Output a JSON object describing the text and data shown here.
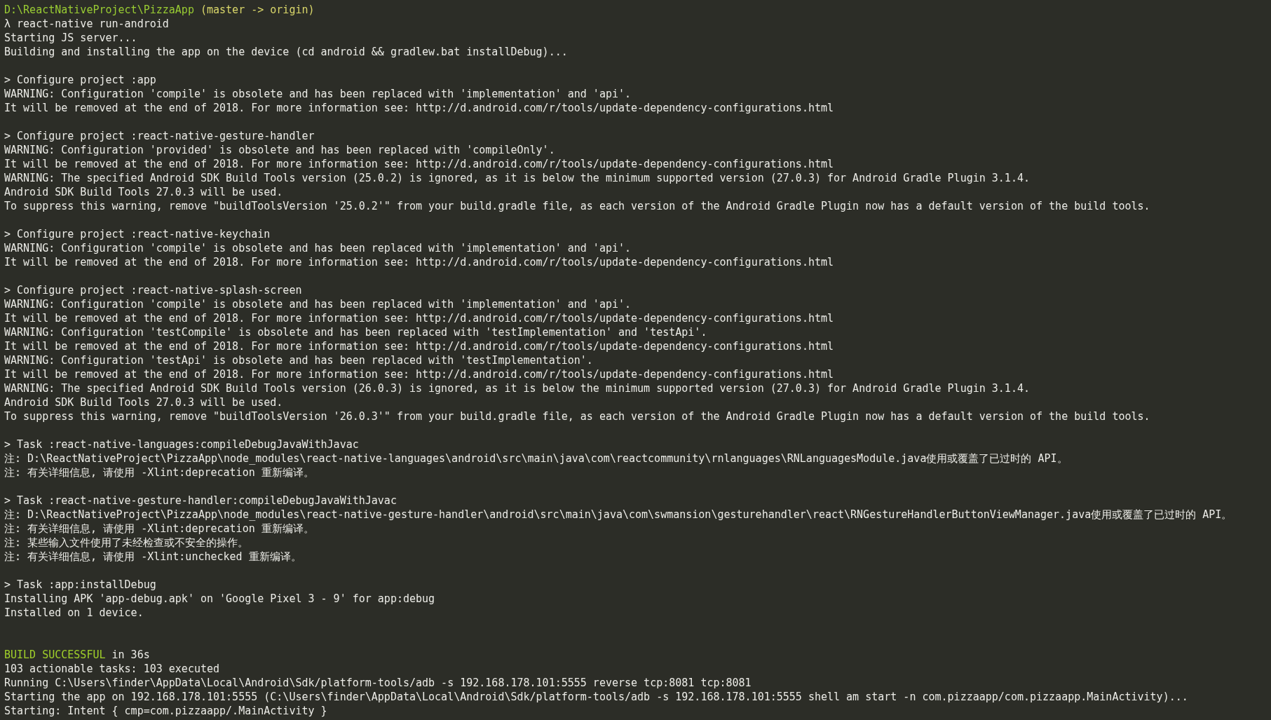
{
  "terminal": {
    "lines": [
      {
        "kind": "colored",
        "spans": [
          {
            "color": "#99cc33",
            "text": "D:\\ReactNativeProject\\PizzaApp"
          },
          {
            "color": "#d9d66a",
            "text": " (master -> origin)"
          }
        ]
      },
      {
        "kind": "text",
        "text": "λ react-native run-android"
      },
      {
        "kind": "text",
        "text": "Starting JS server..."
      },
      {
        "kind": "text",
        "text": "Building and installing the app on the device (cd android && gradlew.bat installDebug)..."
      },
      {
        "kind": "blank"
      },
      {
        "kind": "text",
        "text": "> Configure project :app"
      },
      {
        "kind": "text",
        "text": "WARNING: Configuration 'compile' is obsolete and has been replaced with 'implementation' and 'api'."
      },
      {
        "kind": "text",
        "text": "It will be removed at the end of 2018. For more information see: http://d.android.com/r/tools/update-dependency-configurations.html"
      },
      {
        "kind": "blank"
      },
      {
        "kind": "text",
        "text": "> Configure project :react-native-gesture-handler"
      },
      {
        "kind": "text",
        "text": "WARNING: Configuration 'provided' is obsolete and has been replaced with 'compileOnly'."
      },
      {
        "kind": "text",
        "text": "It will be removed at the end of 2018. For more information see: http://d.android.com/r/tools/update-dependency-configurations.html"
      },
      {
        "kind": "text",
        "text": "WARNING: The specified Android SDK Build Tools version (25.0.2) is ignored, as it is below the minimum supported version (27.0.3) for Android Gradle Plugin 3.1.4."
      },
      {
        "kind": "text",
        "text": "Android SDK Build Tools 27.0.3 will be used."
      },
      {
        "kind": "text",
        "text": "To suppress this warning, remove \"buildToolsVersion '25.0.2'\" from your build.gradle file, as each version of the Android Gradle Plugin now has a default version of the build tools."
      },
      {
        "kind": "blank"
      },
      {
        "kind": "text",
        "text": "> Configure project :react-native-keychain"
      },
      {
        "kind": "text",
        "text": "WARNING: Configuration 'compile' is obsolete and has been replaced with 'implementation' and 'api'."
      },
      {
        "kind": "text",
        "text": "It will be removed at the end of 2018. For more information see: http://d.android.com/r/tools/update-dependency-configurations.html"
      },
      {
        "kind": "blank"
      },
      {
        "kind": "text",
        "text": "> Configure project :react-native-splash-screen"
      },
      {
        "kind": "text",
        "text": "WARNING: Configuration 'compile' is obsolete and has been replaced with 'implementation' and 'api'."
      },
      {
        "kind": "text",
        "text": "It will be removed at the end of 2018. For more information see: http://d.android.com/r/tools/update-dependency-configurations.html"
      },
      {
        "kind": "text",
        "text": "WARNING: Configuration 'testCompile' is obsolete and has been replaced with 'testImplementation' and 'testApi'."
      },
      {
        "kind": "text",
        "text": "It will be removed at the end of 2018. For more information see: http://d.android.com/r/tools/update-dependency-configurations.html"
      },
      {
        "kind": "text",
        "text": "WARNING: Configuration 'testApi' is obsolete and has been replaced with 'testImplementation'."
      },
      {
        "kind": "text",
        "text": "It will be removed at the end of 2018. For more information see: http://d.android.com/r/tools/update-dependency-configurations.html"
      },
      {
        "kind": "text",
        "text": "WARNING: The specified Android SDK Build Tools version (26.0.3) is ignored, as it is below the minimum supported version (27.0.3) for Android Gradle Plugin 3.1.4."
      },
      {
        "kind": "text",
        "text": "Android SDK Build Tools 27.0.3 will be used."
      },
      {
        "kind": "text",
        "text": "To suppress this warning, remove \"buildToolsVersion '26.0.3'\" from your build.gradle file, as each version of the Android Gradle Plugin now has a default version of the build tools."
      },
      {
        "kind": "blank"
      },
      {
        "kind": "text",
        "text": "> Task :react-native-languages:compileDebugJavaWithJavac"
      },
      {
        "kind": "text",
        "text": "注: D:\\ReactNativeProject\\PizzaApp\\node_modules\\react-native-languages\\android\\src\\main\\java\\com\\reactcommunity\\rnlanguages\\RNLanguagesModule.java使用或覆盖了已过时的 API。"
      },
      {
        "kind": "text",
        "text": "注: 有关详细信息, 请使用 -Xlint:deprecation 重新编译。"
      },
      {
        "kind": "blank"
      },
      {
        "kind": "text",
        "text": "> Task :react-native-gesture-handler:compileDebugJavaWithJavac"
      },
      {
        "kind": "text",
        "text": "注: D:\\ReactNativeProject\\PizzaApp\\node_modules\\react-native-gesture-handler\\android\\src\\main\\java\\com\\swmansion\\gesturehandler\\react\\RNGestureHandlerButtonViewManager.java使用或覆盖了已过时的 API。"
      },
      {
        "kind": "text",
        "text": "注: 有关详细信息, 请使用 -Xlint:deprecation 重新编译。"
      },
      {
        "kind": "text",
        "text": "注: 某些输入文件使用了未经检查或不安全的操作。"
      },
      {
        "kind": "text",
        "text": "注: 有关详细信息, 请使用 -Xlint:unchecked 重新编译。"
      },
      {
        "kind": "blank"
      },
      {
        "kind": "text",
        "text": "> Task :app:installDebug"
      },
      {
        "kind": "text",
        "text": "Installing APK 'app-debug.apk' on 'Google Pixel 3 - 9' for app:debug"
      },
      {
        "kind": "text",
        "text": "Installed on 1 device."
      },
      {
        "kind": "blank"
      },
      {
        "kind": "blank"
      },
      {
        "kind": "colored",
        "spans": [
          {
            "color": "#a0d02a",
            "text": "BUILD SUCCESSFUL"
          },
          {
            "color": "#ebebe6",
            "text": " in 36s"
          }
        ]
      },
      {
        "kind": "text",
        "text": "103 actionable tasks: 103 executed"
      },
      {
        "kind": "text",
        "text": "Running C:\\Users\\finder\\AppData\\Local\\Android\\Sdk/platform-tools/adb -s 192.168.178.101:5555 reverse tcp:8081 tcp:8081"
      },
      {
        "kind": "text",
        "text": "Starting the app on 192.168.178.101:5555 (C:\\Users\\finder\\AppData\\Local\\Android\\Sdk/platform-tools/adb -s 192.168.178.101:5555 shell am start -n com.pizzaapp/com.pizzaapp.MainActivity)..."
      },
      {
        "kind": "text",
        "text": "Starting: Intent { cmp=com.pizzaapp/.MainActivity }"
      }
    ]
  }
}
